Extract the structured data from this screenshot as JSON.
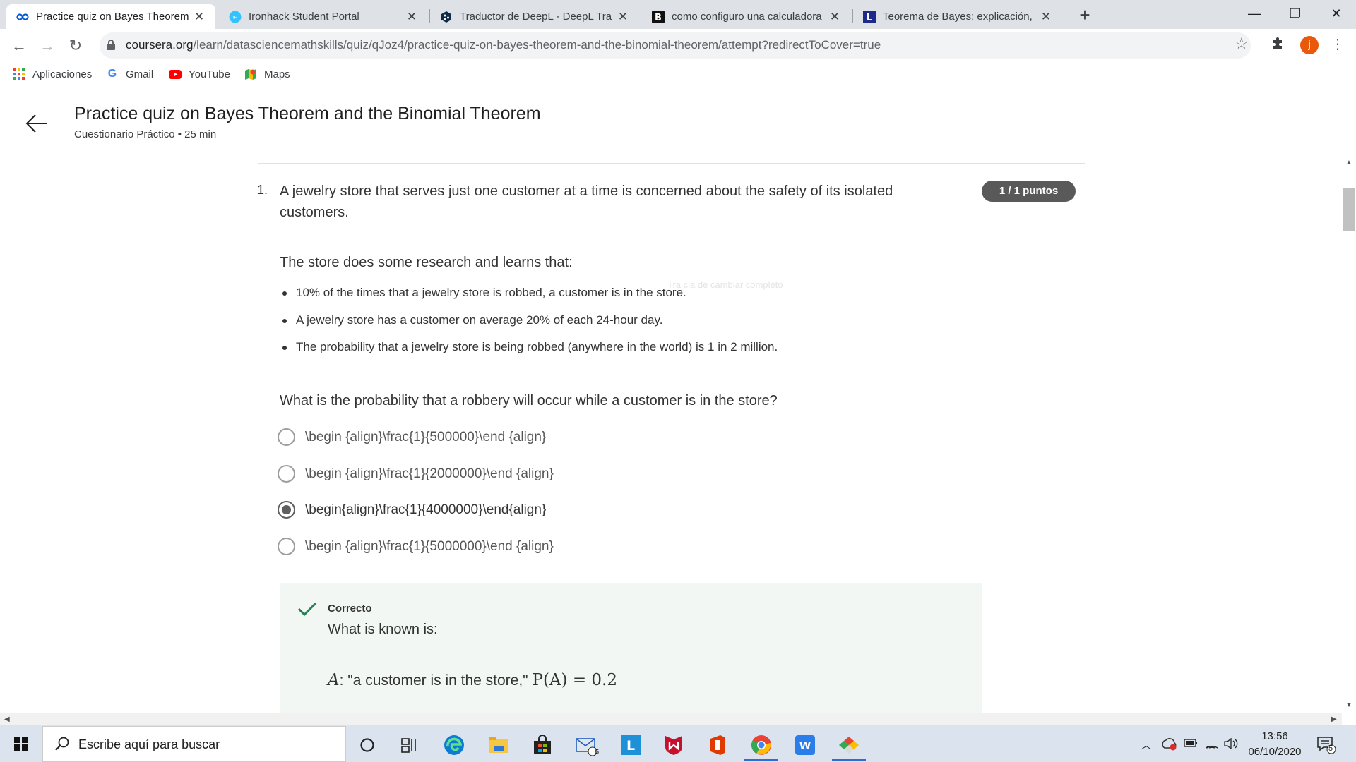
{
  "browser": {
    "tabs": [
      {
        "title": "Practice quiz on Bayes Theorem and the Binomial Theorem",
        "active": true
      },
      {
        "title": "Ironhack Student Portal",
        "active": false
      },
      {
        "title": "Traductor de DeepL - DeepL Translate",
        "active": false
      },
      {
        "title": "como configuro una calculadora",
        "active": false
      },
      {
        "title": "Teorema de Bayes: explicación, aplicaciones",
        "active": false
      }
    ],
    "new_tab_label": "+",
    "url_host": "coursera.org",
    "url_path": "/learn/datasciencemathskills/quiz/qJoz4/practice-quiz-on-bayes-theorem-and-the-binomial-theorem/attempt?redirectToCover=true",
    "profile_initial": "j",
    "bookmarks": [
      {
        "label": "Aplicaciones",
        "icon": "apps-grid-icon"
      },
      {
        "label": "Gmail",
        "icon": "google-icon"
      },
      {
        "label": "YouTube",
        "icon": "youtube-icon"
      },
      {
        "label": "Maps",
        "icon": "maps-icon"
      }
    ]
  },
  "course": {
    "title": "Practice quiz on Bayes Theorem and the Binomial Theorem",
    "subtitle": "Cuestionario Práctico • 25 min"
  },
  "quiz": {
    "number": "1.",
    "question_intro": "A jewelry store that serves just one customer at a time is concerned about the safety of its isolated customers.",
    "score": "1 / 1 puntos",
    "research_intro": "The store does some research and learns that:",
    "facts": [
      "10% of the times that a jewelry store is robbed, a customer is in the store.",
      "A jewelry store has a customer on average 20% of each 24-hour day.",
      "The probability that a jewelry store is being robbed (anywhere in the world) is 1 in 2 million."
    ],
    "ghost_text": "Tra cia de cambiar completo",
    "question": "What is the probability that a robbery will occur while a customer is in the store?",
    "options": [
      {
        "label": "\\begin {align}\\frac{1}{500000}\\end {align}",
        "selected": false
      },
      {
        "label": "\\begin {align}\\frac{1}{2000000}\\end {align}",
        "selected": false
      },
      {
        "label": "\\begin{align}\\frac{1}{4000000}\\end{align}",
        "selected": true
      },
      {
        "label": "\\begin {align}\\frac{1}{5000000}\\end {align}",
        "selected": false
      }
    ],
    "feedback": {
      "status": "Correcto",
      "known_label": "What is known is:",
      "equation_var": "A",
      "equation_text": ": \"a customer is in the store,\" ",
      "equation_math": "P(A) = 0.2"
    }
  },
  "taskbar": {
    "search_placeholder": "Escribe aquí para buscar",
    "mail_badge": "6",
    "time": "13:56",
    "date": "06/10/2020",
    "notification_count": "5"
  },
  "colors": {
    "tab_strip": "#dee1e6",
    "score_pill": "#595959",
    "feedback_bg": "#f2f7f4",
    "correct_green": "#1f8354",
    "profile": "#e8590c"
  }
}
